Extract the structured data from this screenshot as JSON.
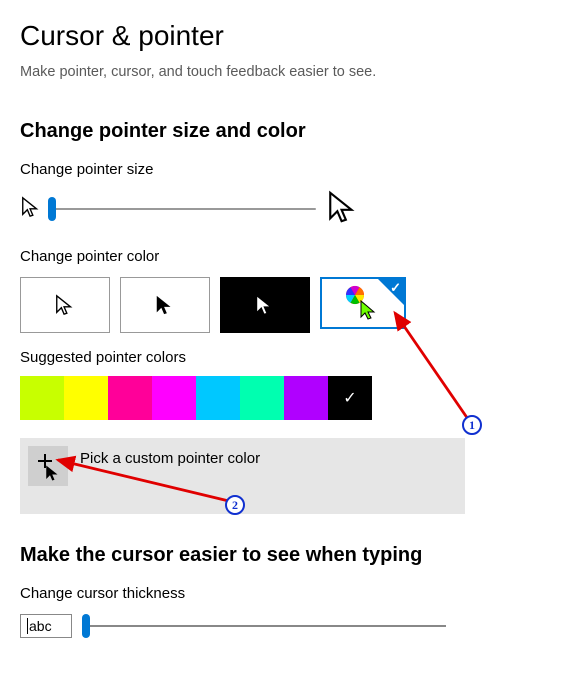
{
  "page": {
    "title": "Cursor & pointer",
    "subtitle": "Make pointer, cursor, and touch feedback easier to see."
  },
  "size_section": {
    "heading": "Change pointer size and color",
    "label": "Change pointer size"
  },
  "color_section": {
    "label": "Change pointer color",
    "options": [
      {
        "name": "white"
      },
      {
        "name": "black"
      },
      {
        "name": "inverted"
      },
      {
        "name": "custom",
        "selected": true
      }
    ]
  },
  "suggested": {
    "label": "Suggested pointer colors",
    "colors": [
      "#c8ff00",
      "#ffff00",
      "#ff0099",
      "#ff00ff",
      "#00c8ff",
      "#00ffb0",
      "#b000ff",
      "#000000"
    ],
    "selected_index": 7
  },
  "custom_picker": {
    "label": "Pick a custom pointer color"
  },
  "thickness_section": {
    "heading": "Make the cursor easier to see when typing",
    "label": "Change cursor thickness",
    "sample": "abc"
  },
  "annotations": {
    "marker1": "1",
    "marker2": "2"
  }
}
